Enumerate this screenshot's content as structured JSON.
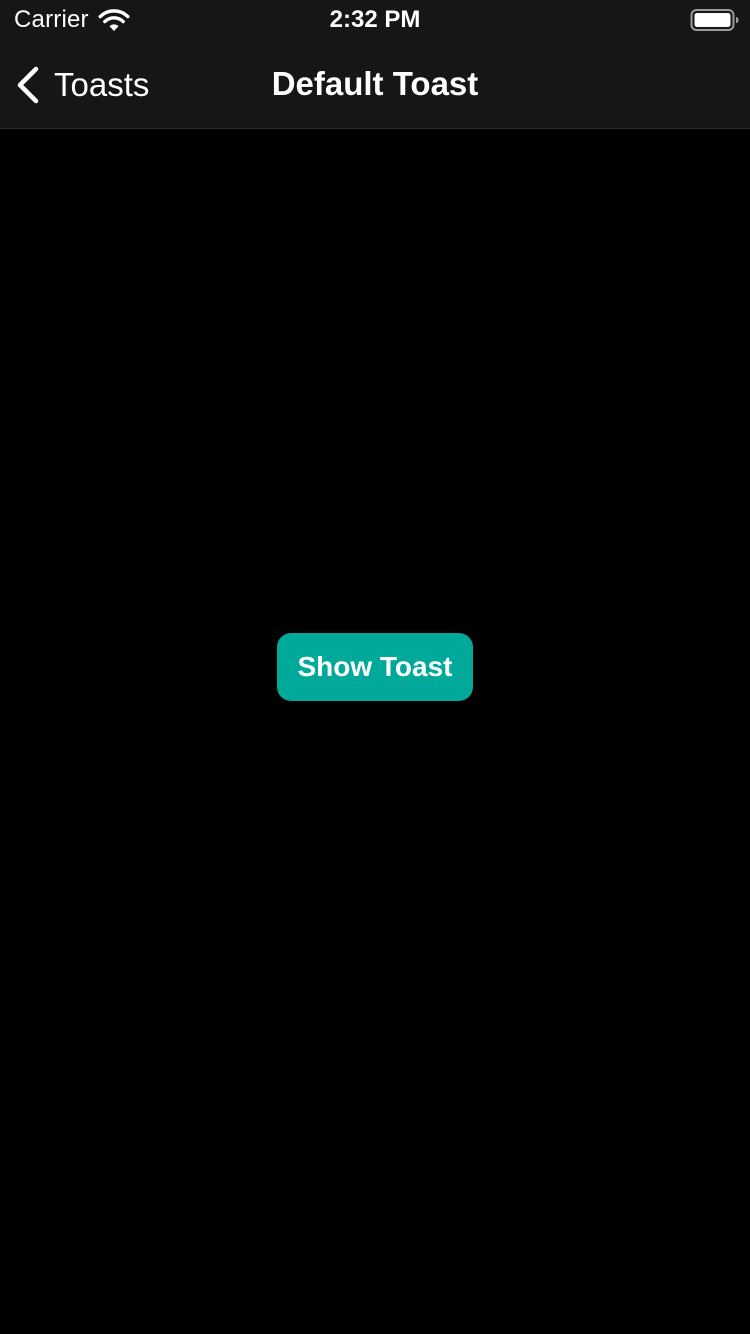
{
  "status_bar": {
    "carrier": "Carrier",
    "time": "2:32 PM",
    "wifi_icon": "wifi-icon",
    "battery_icon": "battery-full-icon"
  },
  "nav_bar": {
    "back_label": "Toasts",
    "back_icon": "chevron-left-icon",
    "title": "Default Toast"
  },
  "main": {
    "show_toast_label": "Show Toast"
  },
  "colors": {
    "background": "#000000",
    "bar_background": "#161616",
    "accent": "#00a99a",
    "text": "#ffffff"
  }
}
